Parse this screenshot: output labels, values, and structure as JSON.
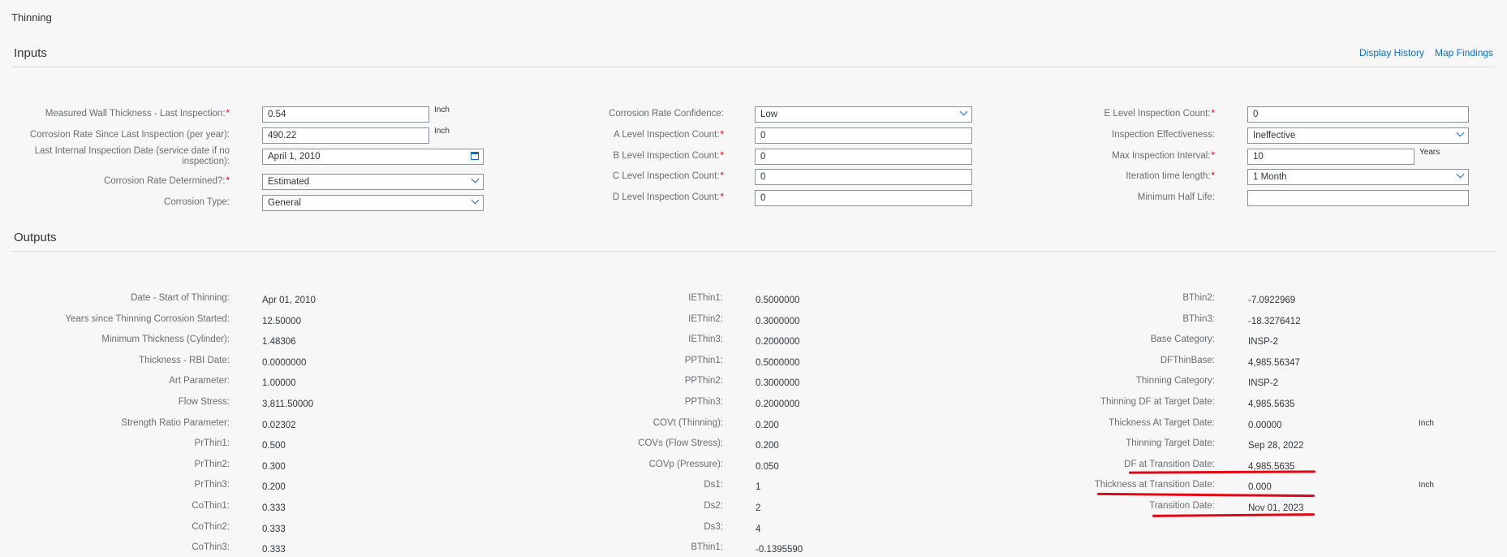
{
  "page_title": "Thinning",
  "links": {
    "display_history": "Display History",
    "map_findings": "Map Findings"
  },
  "inputs": {
    "title": "Inputs",
    "col1": [
      {
        "label": "Measured Wall Thickness - Last Inspection:",
        "required": true,
        "value": "0.54",
        "unit": "Inch",
        "kind": "text"
      },
      {
        "label": "Corrosion Rate Since Last Inspection (per year):",
        "required": false,
        "value": "490.22",
        "unit": "Inch",
        "kind": "text"
      },
      {
        "label": "Last Internal Inspection Date (service date if no inspection):",
        "required": false,
        "value": "April 1, 2010",
        "unit": "",
        "kind": "date"
      },
      {
        "label": "Corrosion Rate Determined?:",
        "required": true,
        "value": "Estimated",
        "unit": "",
        "kind": "select"
      },
      {
        "label": "Corrosion Type:",
        "required": false,
        "value": "General",
        "unit": "",
        "kind": "select"
      }
    ],
    "col2": [
      {
        "label": "Corrosion Rate Confidence:",
        "required": false,
        "value": "Low",
        "kind": "select"
      },
      {
        "label": "A Level Inspection Count:",
        "required": true,
        "value": "0",
        "kind": "text"
      },
      {
        "label": "B Level Inspection Count:",
        "required": true,
        "value": "0",
        "kind": "text"
      },
      {
        "label": "C Level Inspection Count:",
        "required": true,
        "value": "0",
        "kind": "text"
      },
      {
        "label": "D Level Inspection Count:",
        "required": true,
        "value": "0",
        "kind": "text"
      }
    ],
    "col3": [
      {
        "label": "E Level Inspection Count:",
        "required": true,
        "value": "0",
        "unit": "",
        "kind": "text"
      },
      {
        "label": "Inspection Effectiveness:",
        "required": false,
        "value": "Ineffective",
        "unit": "",
        "kind": "select"
      },
      {
        "label": "Max Inspection Interval:",
        "required": true,
        "value": "10",
        "unit": "Years",
        "kind": "text"
      },
      {
        "label": "Iteration time length:",
        "required": true,
        "value": "1 Month",
        "unit": "",
        "kind": "select"
      },
      {
        "label": "Minimum Half Life:",
        "required": false,
        "value": "",
        "unit": "",
        "kind": "text"
      }
    ]
  },
  "outputs": {
    "title": "Outputs",
    "col1": [
      {
        "label": "Date - Start of Thinning:",
        "value": "Apr 01, 2010"
      },
      {
        "label": "Years since Thinning Corrosion Started:",
        "value": "12.50000"
      },
      {
        "label": "Minimum Thickness (Cylinder):",
        "value": "1.48306"
      },
      {
        "label": "Thickness - RBI Date:",
        "value": "0.0000000"
      },
      {
        "label": "Art Parameter:",
        "value": "1.00000"
      },
      {
        "label": "Flow Stress:",
        "value": "3,811.50000"
      },
      {
        "label": "Strength Ratio Parameter:",
        "value": "0.02302"
      },
      {
        "label": "PrThin1:",
        "value": "0.500"
      },
      {
        "label": "PrThin2:",
        "value": "0.300"
      },
      {
        "label": "PrThin3:",
        "value": "0.200"
      },
      {
        "label": "CoThin1:",
        "value": "0.333"
      },
      {
        "label": "CoThin2:",
        "value": "0.333"
      },
      {
        "label": "CoThin3:",
        "value": "0.333"
      }
    ],
    "col2": [
      {
        "label": "IEThin1:",
        "value": "0.5000000"
      },
      {
        "label": "IEThin2:",
        "value": "0.3000000"
      },
      {
        "label": "IEThin3:",
        "value": "0.2000000"
      },
      {
        "label": "PPThin1:",
        "value": "0.5000000"
      },
      {
        "label": "PPThin2:",
        "value": "0.3000000"
      },
      {
        "label": "PPThin3:",
        "value": "0.2000000"
      },
      {
        "label": "COVt (Thinning):",
        "value": "0.200"
      },
      {
        "label": "COVs (Flow Stress):",
        "value": "0.200"
      },
      {
        "label": "COVp (Pressure):",
        "value": "0.050"
      },
      {
        "label": "Ds1:",
        "value": "1"
      },
      {
        "label": "Ds2:",
        "value": "2"
      },
      {
        "label": "Ds3:",
        "value": "4"
      },
      {
        "label": "BThin1:",
        "value": "-0.1395590"
      }
    ],
    "col3": [
      {
        "label": "BThin2:",
        "value": "-7.0922969",
        "unit": ""
      },
      {
        "label": "BThin3:",
        "value": "-18.3276412",
        "unit": ""
      },
      {
        "label": "Base Category:",
        "value": "INSP-2",
        "unit": ""
      },
      {
        "label": "DFThinBase:",
        "value": "4,985.56347",
        "unit": ""
      },
      {
        "label": "Thinning Category:",
        "value": "INSP-2",
        "unit": ""
      },
      {
        "label": "Thinning DF at Target Date:",
        "value": "4,985.5635",
        "unit": ""
      },
      {
        "label": "Thickness At Target Date:",
        "value": "0.00000",
        "unit": "Inch"
      },
      {
        "label": "Thinning Target Date:",
        "value": "Sep 28, 2022",
        "unit": ""
      },
      {
        "label": "DF at Transition Date:",
        "value": "4,985.5635",
        "unit": ""
      },
      {
        "label": "Thickness at Transition Date:",
        "value": "0.000",
        "unit": "Inch"
      },
      {
        "label": "Transition Date:",
        "value": "Nov 01, 2023",
        "unit": ""
      }
    ]
  },
  "annotation_color": "#e30613"
}
